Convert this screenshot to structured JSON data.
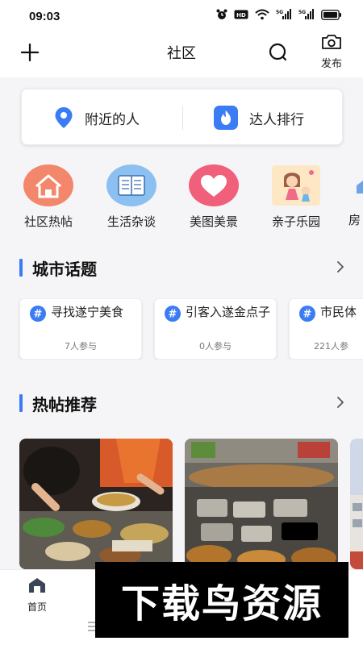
{
  "status_bar": {
    "time": "09:03",
    "icons": [
      "alarm-icon",
      "hd-icon",
      "wifi-icon",
      "signal-5g-icon",
      "signal-5g-icon",
      "battery-icon"
    ]
  },
  "header": {
    "title": "社区",
    "left_icon": "plus-icon",
    "search_icon": "search-icon",
    "publish_label": "发布",
    "publish_icon": "camera-icon"
  },
  "quick_actions": [
    {
      "label": "附近的人",
      "icon": "location-pin-icon",
      "color": "#3b7cf5"
    },
    {
      "label": "达人排行",
      "icon": "flame-icon",
      "color": "#3b7cf5"
    }
  ],
  "categories": [
    {
      "label": "社区热帖",
      "icon": "house-icon",
      "color": "#f3876b"
    },
    {
      "label": "生活杂谈",
      "icon": "book-icon",
      "color": "#7fb6ec"
    },
    {
      "label": "美图美景",
      "icon": "heart-icon",
      "color": "#f0607a"
    },
    {
      "label": "亲子乐园",
      "icon": "family-icon",
      "color": "#f9d08a"
    },
    {
      "label": "房",
      "icon": "house-partial-icon",
      "color": "#4a8ee6"
    }
  ],
  "city_topics": {
    "title": "城市话题",
    "items": [
      {
        "title": "寻找遂宁美食",
        "count": "7人参与"
      },
      {
        "title": "引客入遂金点子",
        "count": "0人参与"
      },
      {
        "title": "市民体",
        "count": "221人参"
      }
    ]
  },
  "hot_posts": {
    "title": "热帖推荐"
  },
  "bottom_nav": {
    "home_label": "首页",
    "home_icon": "home-icon",
    "menu_icon": "menu-icon"
  },
  "watermark": {
    "text": "下载鸟资源"
  },
  "colors": {
    "accent": "#3b7cf5",
    "background": "#f5f5f7",
    "card": "#ffffff"
  }
}
